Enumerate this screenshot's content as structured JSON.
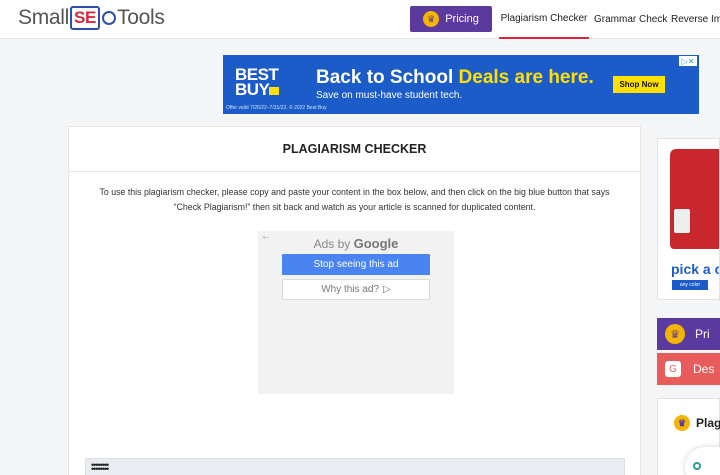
{
  "header": {
    "logo": {
      "pre": "Small",
      "seo": "SE",
      "post": "Tools"
    },
    "pricing_label": "Pricing",
    "nav": [
      "Plagiarism Checker",
      "Grammar Check",
      "Reverse Ima"
    ]
  },
  "top_ad": {
    "brand_line1": "BEST",
    "brand_line2": "BUY",
    "headline_white": "Back to School ",
    "headline_yellow": "Deals are here.",
    "subline": "Save on must-have student tech.",
    "cta": "Shop Now",
    "fine_print": "Offer valid 7/26/22–7/31/22. © 2022 Best Buy",
    "close": "▷✕"
  },
  "main": {
    "title": "PLAGIARISM CHECKER",
    "intro": "To use this plagiarism checker, please copy and paste your content in the box below, and then click on the big blue button that says “Check Plagiarism!” then sit back and watch as your article is scanned for duplicated content.",
    "google_ad": {
      "ads_by": "Ads by ",
      "google": "Google",
      "stop": "Stop seeing this ad",
      "why": "Why this ad?",
      "why_icon": "▷"
    }
  },
  "sidebar": {
    "ad_text": "pick a c",
    "ad_cta": "any color",
    "pricing_label": "Pri",
    "des_label": "Des",
    "plag_label": "Plag"
  },
  "colors": {
    "brand_purple": "#5b3aa0",
    "accent_red": "#d7263d",
    "ad_blue": "#1b5cc8",
    "ad_yellow": "#ffe000",
    "google_blue": "#4a84f0"
  }
}
